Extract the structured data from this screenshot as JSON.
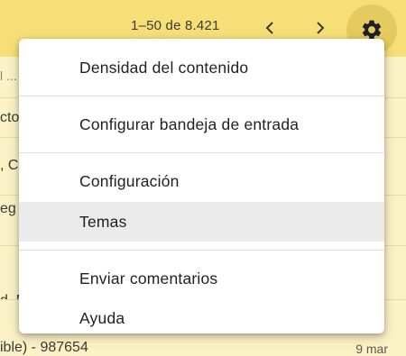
{
  "toolbar": {
    "pager": "1–50 de 8.421",
    "prev_icon": "chevron-left-icon",
    "next_icon": "chevron-right-icon",
    "settings_icon": "gear-icon"
  },
  "list": {
    "rows": [
      {
        "text": "l ..."
      },
      {
        "text": "cto"
      },
      {
        "text": ", C"
      },
      {
        "text": "eg"
      },
      {
        "text": "d, M"
      },
      {
        "text": "ible) - 987654",
        "date": "9 mar"
      }
    ]
  },
  "menu": {
    "items": [
      {
        "label": "Densidad del contenido"
      },
      {
        "label": "Configurar bandeja de entrada"
      },
      {
        "label": "Configuración"
      },
      {
        "label": "Temas",
        "highlighted": true
      },
      {
        "label": "Enviar comentarios"
      },
      {
        "label": "Ayuda"
      }
    ]
  },
  "colors": {
    "toolbar_bg": "#f7df78",
    "list_bg": "#fbf2c6",
    "gear_active_bg": "#e5cb5f",
    "menu_hover": "#ebebeb"
  }
}
